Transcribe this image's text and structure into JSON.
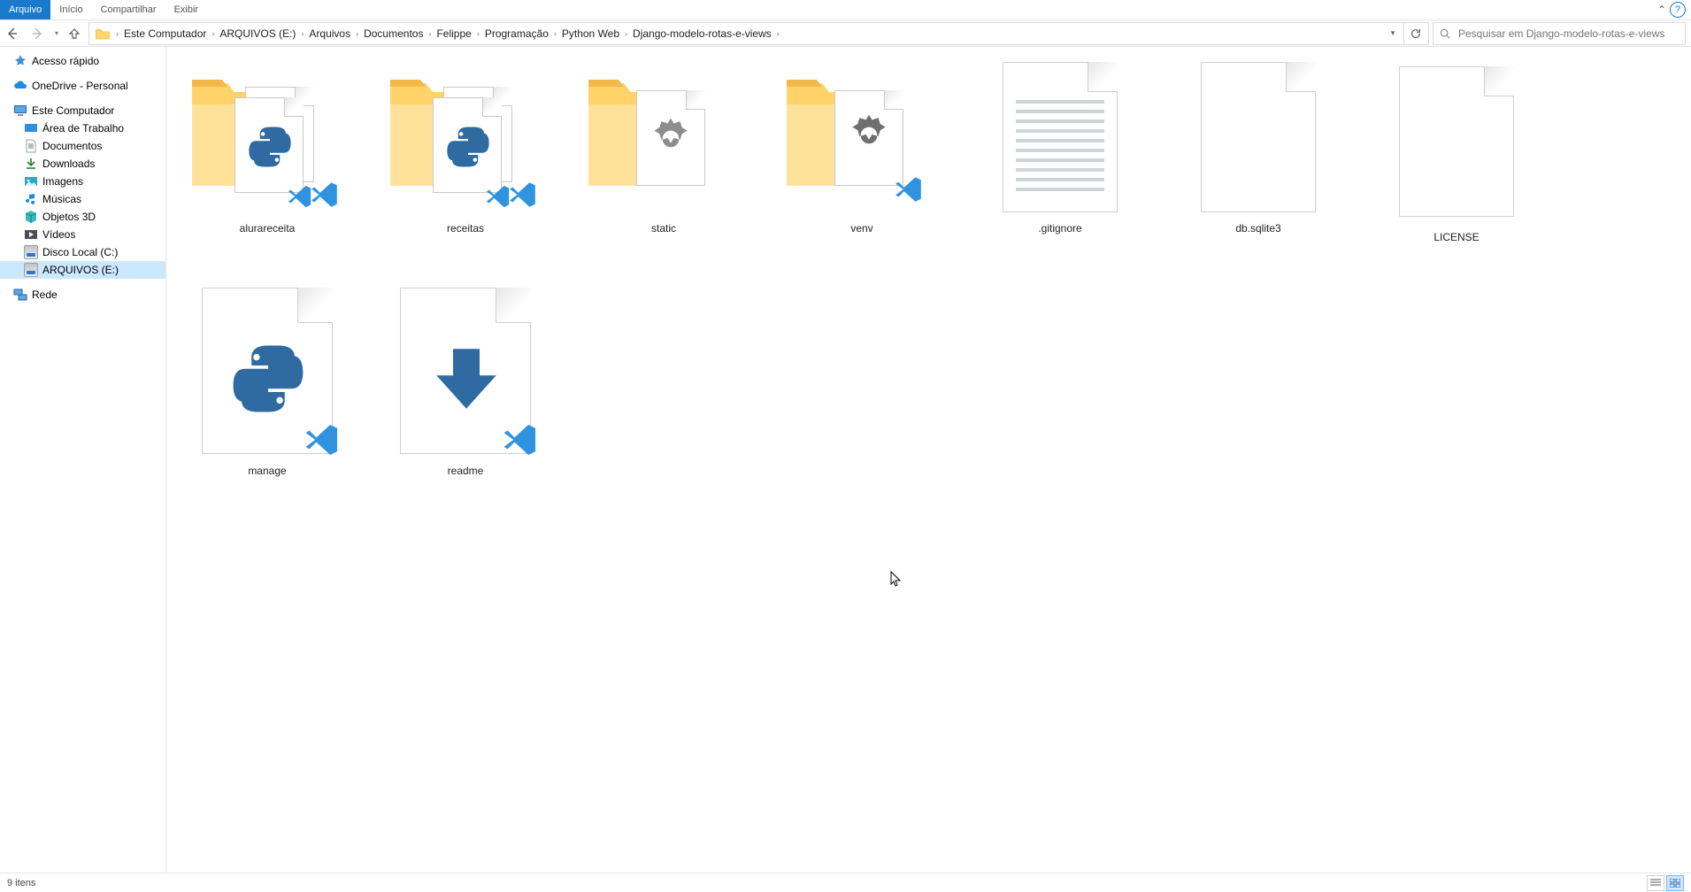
{
  "menu": {
    "items": [
      "Arquivo",
      "Início",
      "Compartilhar",
      "Exibir"
    ],
    "active_index": 0
  },
  "breadcrumbs": [
    "Este Computador",
    "ARQUIVOS (E:)",
    "Arquivos",
    "Documentos",
    "Felippe",
    "Programação",
    "Python Web",
    "Django-modelo-rotas-e-views"
  ],
  "search": {
    "placeholder": "Pesquisar em Django-modelo-rotas-e-views"
  },
  "tree": {
    "quick_access": "Acesso rápido",
    "onedrive": "OneDrive - Personal",
    "this_pc": "Este Computador",
    "desktop": "Área de Trabalho",
    "documents": "Documentos",
    "downloads": "Downloads",
    "pictures": "Imagens",
    "music": "Músicas",
    "objects3d": "Objetos 3D",
    "videos": "Vídeos",
    "disk_c": "Disco Local (C:)",
    "disk_e": "ARQUIVOS (E:)",
    "network": "Rede"
  },
  "items": [
    {
      "name": "alurareceita",
      "kind": "folder-python"
    },
    {
      "name": "receitas",
      "kind": "folder-python"
    },
    {
      "name": "static",
      "kind": "folder-settings"
    },
    {
      "name": "venv",
      "kind": "folder-settings-vs"
    },
    {
      "name": ".gitignore",
      "kind": "textfile"
    },
    {
      "name": "db.sqlite3",
      "kind": "blankfile"
    },
    {
      "name": "LICENSE",
      "kind": "blankfile-small"
    },
    {
      "name": "manage",
      "kind": "pyfile-vs"
    },
    {
      "name": "readme",
      "kind": "mdfile-vs"
    }
  ],
  "status": {
    "count_label": "9 itens"
  }
}
